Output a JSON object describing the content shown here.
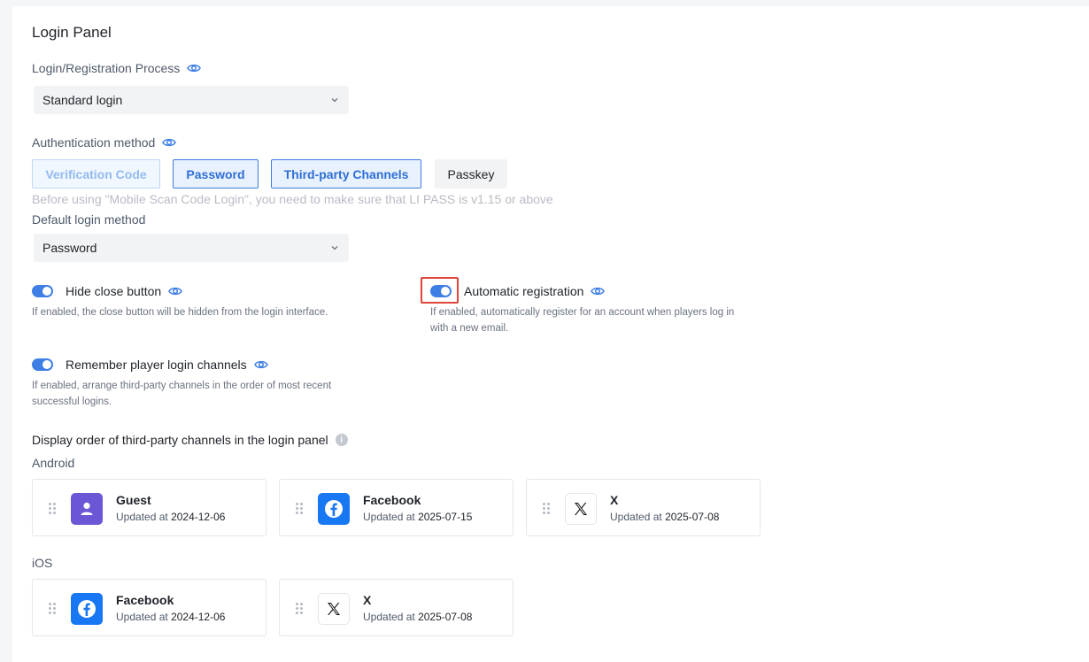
{
  "panel": {
    "title": "Login Panel"
  },
  "process": {
    "label": "Login/Registration Process",
    "value": "Standard login"
  },
  "auth": {
    "label": "Authentication method",
    "buttons": [
      "Verification Code",
      "Password",
      "Third-party Channels",
      "Passkey"
    ],
    "hint": "Before using \"Mobile Scan Code Login\", you need to make sure that LI PASS is v1.15 or above"
  },
  "default_method": {
    "label": "Default login method",
    "value": "Password"
  },
  "toggles": {
    "hide_close": {
      "label": "Hide close button",
      "desc": "If enabled, the close button will be hidden from the login interface.",
      "on": true
    },
    "auto_reg": {
      "label": "Automatic registration",
      "desc1": "If enabled, automatically register for an account when players log in",
      "desc2": "with a new email.",
      "on": true
    },
    "remember": {
      "label": "Remember player login channels",
      "desc1": "If enabled, arrange third-party channels in the order of most recent",
      "desc2": "successful logins.",
      "on": true
    }
  },
  "order": {
    "label": "Display order of third-party channels in the login panel",
    "info_icon": "i",
    "updated_prefix": "Updated at",
    "android": {
      "label": "Android",
      "cards": [
        {
          "name": "Guest",
          "date": "2024-12-06",
          "icon": "guest-icon",
          "color": "#6b57d6"
        },
        {
          "name": "Facebook",
          "date": "2025-07-15",
          "icon": "facebook-icon",
          "color": "#1877f2"
        },
        {
          "name": "X",
          "date": "2025-07-08",
          "icon": "x-icon",
          "color": "#ffffff"
        }
      ]
    },
    "ios": {
      "label": "iOS",
      "cards": [
        {
          "name": "Facebook",
          "date": "2024-12-06",
          "icon": "facebook-icon",
          "color": "#1877f2"
        },
        {
          "name": "X",
          "date": "2025-07-08",
          "icon": "x-icon",
          "color": "#ffffff"
        }
      ]
    }
  },
  "colors": {
    "accent": "#3d7fe5",
    "highlight": "#e0443a"
  }
}
